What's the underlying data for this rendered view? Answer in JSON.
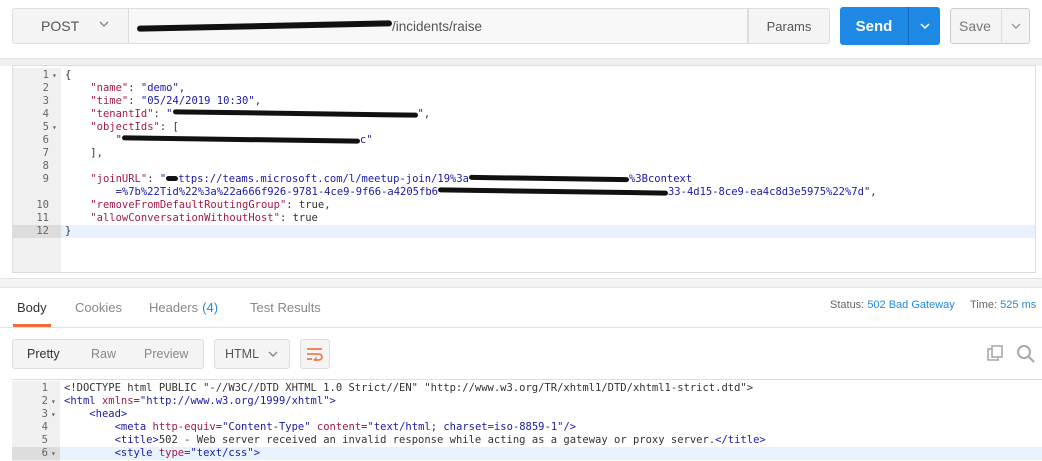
{
  "request": {
    "method": "POST",
    "url_suffix": "/incidents/raise",
    "params_label": "Params",
    "send_label": "Send",
    "save_label": "Save"
  },
  "body_editor": {
    "lines": [
      {
        "n": "1",
        "fold": true,
        "parts": [
          {
            "t": "{"
          }
        ]
      },
      {
        "n": "2",
        "parts": [
          {
            "t": "    "
          },
          {
            "c": "k",
            "t": "\"name\""
          },
          {
            "t": ": "
          },
          {
            "c": "s",
            "t": "\"demo\""
          },
          {
            "t": ","
          }
        ]
      },
      {
        "n": "3",
        "parts": [
          {
            "t": "    "
          },
          {
            "c": "k",
            "t": "\"time\""
          },
          {
            "t": ": "
          },
          {
            "c": "s",
            "t": "\"05/24/2019 10:30\""
          },
          {
            "t": ","
          }
        ]
      },
      {
        "n": "4",
        "parts": [
          {
            "t": "    "
          },
          {
            "c": "k",
            "t": "\"tenantId\""
          },
          {
            "t": ": "
          },
          {
            "c": "s",
            "t": "\""
          },
          {
            "m": 245
          },
          {
            "c": "s",
            "t": "\""
          },
          {
            "t": ","
          }
        ]
      },
      {
        "n": "5",
        "fold": true,
        "parts": [
          {
            "t": "    "
          },
          {
            "c": "k",
            "t": "\"objectIds\""
          },
          {
            "t": ": ["
          }
        ]
      },
      {
        "n": "6",
        "parts": [
          {
            "t": "        "
          },
          {
            "c": "s",
            "t": "\""
          },
          {
            "m": 238
          },
          {
            "c": "s",
            "t": "c\""
          }
        ]
      },
      {
        "n": "7",
        "parts": [
          {
            "t": "    ],"
          }
        ]
      },
      {
        "n": "8",
        "parts": [
          {
            "t": ""
          }
        ]
      },
      {
        "n": "9",
        "parts": [
          {
            "t": "    "
          },
          {
            "c": "k",
            "t": "\"joinURL\""
          },
          {
            "t": ": "
          },
          {
            "c": "s",
            "t": "\""
          },
          {
            "m": 12
          },
          {
            "c": "s",
            "t": "ttps://teams.microsoft.com/l/meetup-join/19%3a"
          },
          {
            "m": 160
          },
          {
            "c": "s",
            "t": "%3Bcontext"
          }
        ]
      },
      {
        "n": "",
        "parts": [
          {
            "c": "s",
            "t": "        =%7b%22Tid%22%3a%22a666f926-9781-4ce9-9f66-a4205fb6"
          },
          {
            "m": 230
          },
          {
            "c": "s",
            "t": "33-4d15-8ce9-ea4c8d3e5975%22%7d\""
          },
          {
            "t": ","
          }
        ]
      },
      {
        "n": "10",
        "parts": [
          {
            "t": "    "
          },
          {
            "c": "k",
            "t": "\"removeFromDefaultRoutingGroup\""
          },
          {
            "t": ": true,"
          }
        ]
      },
      {
        "n": "11",
        "parts": [
          {
            "t": "    "
          },
          {
            "c": "k",
            "t": "\"allowConversationWithoutHost\""
          },
          {
            "t": ": true"
          }
        ]
      },
      {
        "n": "12",
        "active": true,
        "parts": [
          {
            "t": "}"
          }
        ]
      }
    ]
  },
  "response": {
    "tabs": [
      {
        "label": "Body",
        "active": true
      },
      {
        "label": "Cookies"
      },
      {
        "label": "Headers",
        "count": "(4)"
      },
      {
        "label": "Test Results"
      }
    ],
    "status_label": "Status:",
    "status_value": "502 Bad Gateway",
    "time_label": "Time:",
    "time_value": "525 ms",
    "views": [
      {
        "label": "Pretty",
        "active": true
      },
      {
        "label": "Raw"
      },
      {
        "label": "Preview"
      }
    ],
    "format": "HTML",
    "lines": [
      {
        "n": "1",
        "parts": [
          {
            "t": "<!DOCTYPE html PUBLIC \"-//W3C//DTD XHTML 1.0 Strict//EN\" \"http://www.w3.org/TR/xhtml1/DTD/xhtml1-strict.dtd\">"
          }
        ]
      },
      {
        "n": "2",
        "fold": true,
        "parts": [
          {
            "c": "tag",
            "t": "<html "
          },
          {
            "c": "k",
            "t": "xmlns"
          },
          {
            "t": "="
          },
          {
            "c": "s",
            "t": "\"http://www.w3.org/1999/xhtml\""
          },
          {
            "c": "tag",
            "t": ">"
          }
        ]
      },
      {
        "n": "3",
        "fold": true,
        "parts": [
          {
            "t": "    "
          },
          {
            "c": "tag",
            "t": "<head>"
          }
        ]
      },
      {
        "n": "4",
        "parts": [
          {
            "t": "        "
          },
          {
            "c": "tag",
            "t": "<meta "
          },
          {
            "c": "k",
            "t": "http-equiv"
          },
          {
            "t": "="
          },
          {
            "c": "s",
            "t": "\"Content-Type\""
          },
          {
            "t": " "
          },
          {
            "c": "k",
            "t": "content"
          },
          {
            "t": "="
          },
          {
            "c": "s",
            "t": "\"text/html; charset=iso-8859-1\""
          },
          {
            "c": "tag",
            "t": "/>"
          }
        ]
      },
      {
        "n": "5",
        "parts": [
          {
            "t": "        "
          },
          {
            "c": "tag",
            "t": "<title>"
          },
          {
            "t": "502 - Web server received an invalid response while acting as a gateway or proxy server."
          },
          {
            "c": "tag",
            "t": "</title>"
          }
        ]
      },
      {
        "n": "6",
        "fold": true,
        "active": true,
        "parts": [
          {
            "t": "        "
          },
          {
            "c": "tag",
            "t": "<style "
          },
          {
            "c": "k",
            "t": "type"
          },
          {
            "t": "="
          },
          {
            "c": "s",
            "t": "\"text/css\""
          },
          {
            "c": "tag",
            "t": ">"
          }
        ]
      }
    ]
  },
  "colors": {
    "accent": "#1e88e5",
    "tab_underline": "#f26b3a"
  }
}
